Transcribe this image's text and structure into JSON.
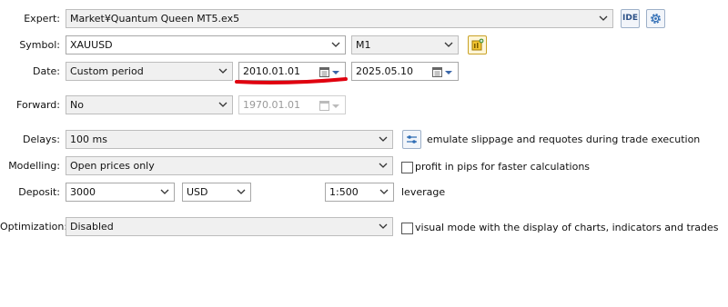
{
  "labels": {
    "expert": "Expert:",
    "symbol": "Symbol:",
    "date": "Date:",
    "forward": "Forward:",
    "delays": "Delays:",
    "modelling": "Modelling:",
    "deposit": "Deposit:",
    "optimization": "Optimization:"
  },
  "expert": {
    "value": "Market¥Quantum Queen MT5.ex5",
    "ide_label": "IDE"
  },
  "symbol": {
    "value": "XAUUSD",
    "timeframe": "M1"
  },
  "date": {
    "mode": "Custom period",
    "from": "2010.01.01",
    "to": "2025.05.10"
  },
  "forward": {
    "value": "No",
    "date": "1970.01.01"
  },
  "delays": {
    "value": "100 ms",
    "emulate_text": "emulate slippage and requotes during trade execution"
  },
  "modelling": {
    "value": "Open prices only",
    "profit_pips_text": "profit in pips for faster calculations",
    "profit_pips_checked": false
  },
  "deposit": {
    "amount": "3000",
    "currency": "USD",
    "leverage": "1:500",
    "leverage_text": "leverage"
  },
  "optimization": {
    "value": "Disabled",
    "visual_mode_text": "visual mode with the display of charts, indicators and trades",
    "visual_mode_checked": false
  },
  "annotation": {
    "color": "#e0000f"
  }
}
